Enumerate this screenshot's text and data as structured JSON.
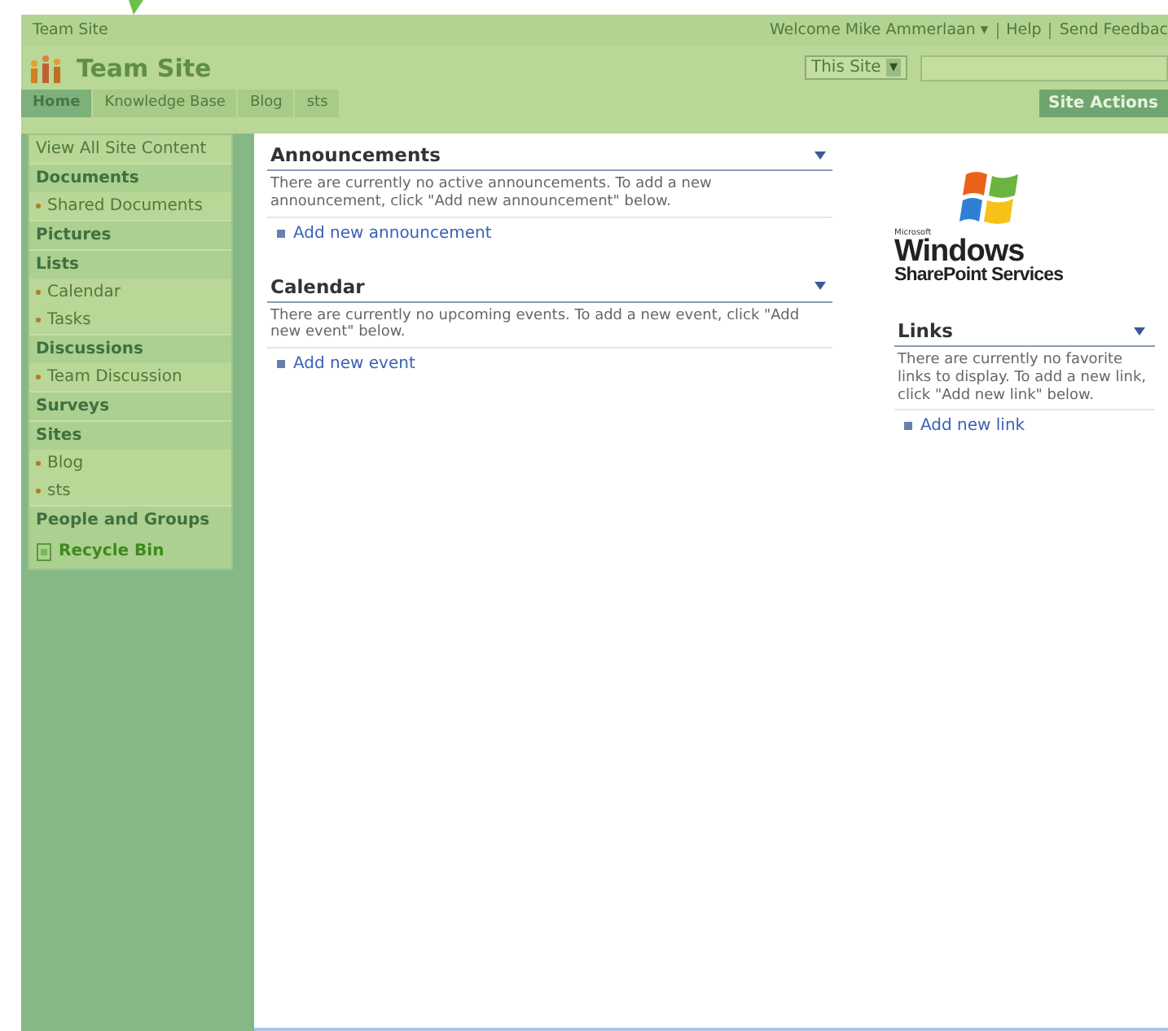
{
  "top_bar": {
    "breadcrumb": "Team Site",
    "welcome": "Welcome Mike Ammerlaan",
    "caret": "▾",
    "links": [
      "Help",
      "Send Feedbac"
    ]
  },
  "title_row": {
    "title": "Team Site",
    "scope": "This Site",
    "scope_caret": "▾"
  },
  "tabs": [
    {
      "label": "Home",
      "selected": true
    },
    {
      "label": "Knowledge Base",
      "selected": false
    },
    {
      "label": "Blog",
      "selected": false
    },
    {
      "label": "sts",
      "selected": false
    }
  ],
  "site_actions": "Site Actions",
  "sidebar": {
    "items": [
      {
        "kind": "link",
        "label": "View All Site Content"
      },
      {
        "kind": "heading",
        "label": "Documents"
      },
      {
        "kind": "bullet",
        "label": "Shared Documents"
      },
      {
        "kind": "heading",
        "label": "Pictures"
      },
      {
        "kind": "heading",
        "label": "Lists"
      },
      {
        "kind": "bullet",
        "label": "Calendar"
      },
      {
        "kind": "bullet",
        "label": "Tasks"
      },
      {
        "kind": "heading",
        "label": "Discussions"
      },
      {
        "kind": "bullet",
        "label": "Team Discussion"
      },
      {
        "kind": "heading",
        "label": "Surveys"
      },
      {
        "kind": "heading",
        "label": "Sites"
      },
      {
        "kind": "bullet",
        "label": "Blog"
      },
      {
        "kind": "bullet",
        "label": "sts"
      },
      {
        "kind": "heading",
        "label": "People and Groups"
      },
      {
        "kind": "recycle",
        "label": "Recycle Bin"
      }
    ]
  },
  "web_parts": [
    {
      "title": "Announcements",
      "message": "There are currently no active announcements. To add a new announcement, click \"Add new announcement\" below.",
      "link": "Add new announcement"
    },
    {
      "title": "Calendar",
      "message": "There are currently no upcoming events. To add a new event, click \"Add new event\" below.",
      "link": "Add new event"
    }
  ],
  "logo": {
    "brand": "Microsoft",
    "product": "Windows",
    "subtitle": "SharePoint Services"
  },
  "links_part": {
    "title": "Links",
    "message": "There are currently no favorite links to display. To add a new link, click \"Add new link\" below.",
    "link": "Add new link"
  }
}
